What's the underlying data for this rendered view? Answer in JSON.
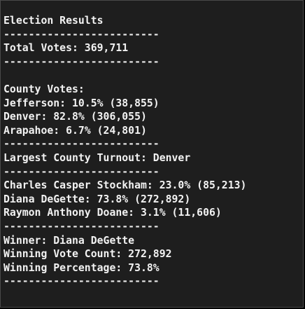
{
  "terminal": {
    "lines": [
      {
        "kind": "text",
        "text": "Election Results"
      },
      {
        "kind": "sep",
        "text": "-------------------------"
      },
      {
        "kind": "text",
        "text": "Total Votes: 369,711"
      },
      {
        "kind": "sep",
        "text": "-------------------------"
      },
      {
        "kind": "blank",
        "text": ""
      },
      {
        "kind": "text",
        "text": "County Votes:"
      },
      {
        "kind": "text",
        "text": "Jefferson: 10.5% (38,855)"
      },
      {
        "kind": "text",
        "text": "Denver: 82.8% (306,055)"
      },
      {
        "kind": "text",
        "text": "Arapahoe: 6.7% (24,801)"
      },
      {
        "kind": "sep",
        "text": "-------------------------"
      },
      {
        "kind": "text",
        "text": "Largest County Turnout: Denver"
      },
      {
        "kind": "sep",
        "text": "-------------------------"
      },
      {
        "kind": "text",
        "text": "Charles Casper Stockham: 23.0% (85,213)"
      },
      {
        "kind": "text",
        "text": "Diana DeGette: 73.8% (272,892)"
      },
      {
        "kind": "text",
        "text": "Raymon Anthony Doane: 3.1% (11,606)"
      },
      {
        "kind": "sep",
        "text": "-------------------------"
      },
      {
        "kind": "text",
        "text": "Winner: Diana DeGette"
      },
      {
        "kind": "text",
        "text": "Winning Vote Count: 272,892"
      },
      {
        "kind": "text",
        "text": "Winning Percentage: 73.8%"
      },
      {
        "kind": "sep",
        "text": "-------------------------"
      }
    ]
  },
  "colors": {
    "background": "#1e1e1e",
    "text": "#f2f2f2",
    "border": "#4a4a4a"
  }
}
